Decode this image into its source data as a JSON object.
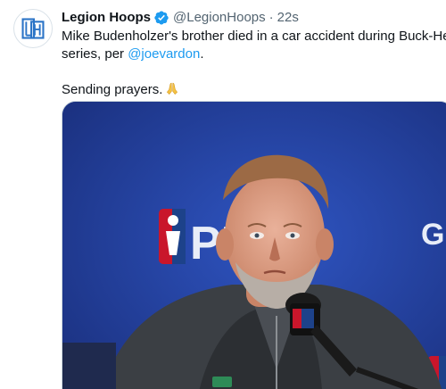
{
  "tweet": {
    "display_name": "Legion Hoops",
    "handle": "@LegionHoops",
    "separator": "·",
    "time": "22s",
    "text_line1": "Mike Budenholzer's brother died in a car accident during Buck-Heat",
    "text_line2_prefix": "series, per ",
    "mention": "@joevardon",
    "text_line2_suffix": ".",
    "text_line3": "Sending prayers.",
    "emoji": "folded-hands-emoji"
  },
  "icons": {
    "avatar": "legion-hoops-logo",
    "verified": "verified-badge-icon"
  },
  "colors": {
    "accent": "#1d9bf0",
    "text": "#0f1419",
    "muted": "#536471",
    "backdrop": "#233f9c"
  },
  "media": {
    "backdrop_partial_text": "PL",
    "backdrop_partial_text_right": "G"
  }
}
